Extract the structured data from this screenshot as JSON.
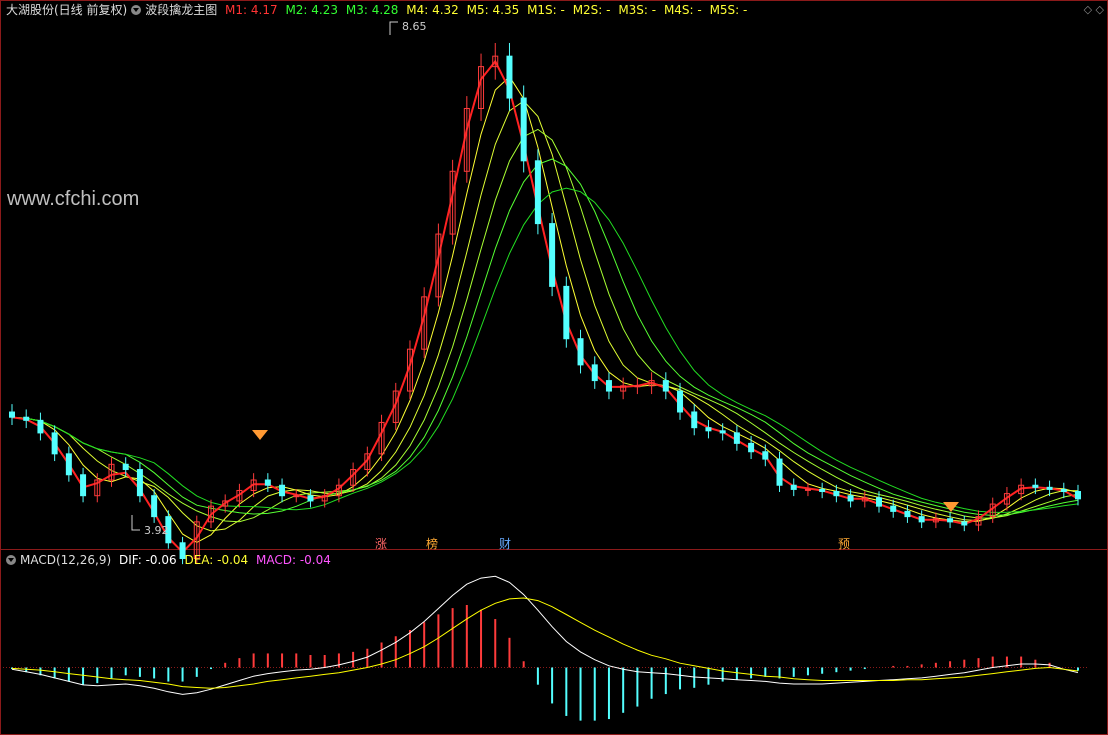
{
  "header": {
    "stock_name": "大湖股份(日线 前复权)",
    "indicator_name": "波段擒龙主图",
    "items": [
      {
        "label": "M1: 4.17",
        "color": "#ff3333"
      },
      {
        "label": "M2: 4.23",
        "color": "#33ff33"
      },
      {
        "label": "M3: 4.28",
        "color": "#33ff33"
      },
      {
        "label": "M4: 4.32",
        "color": "#ffff33"
      },
      {
        "label": "M5: 4.35",
        "color": "#ffff33"
      },
      {
        "label": "M1S: -",
        "color": "#ffff33"
      },
      {
        "label": "M2S: -",
        "color": "#ffff33"
      },
      {
        "label": "M3S: -",
        "color": "#ffff33"
      },
      {
        "label": "M4S: -",
        "color": "#ffff33"
      },
      {
        "label": "M5S: -",
        "color": "#ffff33"
      }
    ]
  },
  "watermark": "www.cfchi.com",
  "annotations": {
    "high": "8.65",
    "low": "3.92"
  },
  "event_tags": [
    {
      "text": "涨",
      "color": "#ff6666"
    },
    {
      "text": "榜",
      "color": "#ffaa33"
    },
    {
      "text": "财",
      "color": "#66aaff"
    },
    {
      "text": "预",
      "color": "#ffaa33"
    }
  ],
  "macd_header": {
    "name": "MACD(12,26,9)",
    "dif": "DIF: -0.06",
    "dea": "DEA: -0.04",
    "macd": "MACD: -0.04"
  },
  "colors": {
    "up": "#ff3b3b",
    "down": "#54ffff",
    "dif": "#ffffff",
    "dea": "#ffff00",
    "frame": "#8b1a1a"
  },
  "chart_data": [
    {
      "type": "candlestick",
      "title": "大湖股份(日线 前复权)",
      "ylim": [
        3.92,
        8.65
      ],
      "series": [
        {
          "name": "close",
          "values": [
            4.95,
            4.92,
            4.8,
            4.6,
            4.4,
            4.2,
            4.35,
            4.5,
            4.45,
            4.2,
            4.0,
            3.75,
            3.6,
            3.95,
            4.1,
            4.15,
            4.25,
            4.35,
            4.3,
            4.2,
            4.2,
            4.15,
            4.2,
            4.3,
            4.45,
            4.6,
            4.9,
            5.2,
            5.6,
            6.1,
            6.7,
            7.3,
            7.9,
            8.3,
            8.4,
            8.0,
            7.4,
            6.8,
            6.2,
            5.7,
            5.45,
            5.3,
            5.2,
            5.25,
            5.25,
            5.3,
            5.2,
            5.0,
            4.85,
            4.82,
            4.8,
            4.7,
            4.62,
            4.55,
            4.3,
            4.26,
            4.26,
            4.24,
            4.2,
            4.15,
            4.18,
            4.1,
            4.05,
            4.0,
            3.95,
            3.98,
            3.95,
            3.92,
            4.0,
            4.12,
            4.22,
            4.3,
            4.28,
            4.26,
            4.24,
            4.17
          ]
        },
        {
          "name": "M1",
          "values": [
            4.95,
            4.93,
            4.86,
            4.7,
            4.5,
            4.28,
            4.32,
            4.4,
            4.42,
            4.26,
            4.04,
            3.8,
            3.66,
            3.8,
            4.02,
            4.13,
            4.21,
            4.31,
            4.31,
            4.24,
            4.21,
            4.17,
            4.19,
            4.27,
            4.4,
            4.54,
            4.8,
            5.08,
            5.45,
            5.92,
            6.48,
            7.08,
            7.7,
            8.18,
            8.35,
            8.08,
            7.55,
            6.96,
            6.37,
            5.86,
            5.54,
            5.36,
            5.24,
            5.24,
            5.25,
            5.28,
            5.23,
            5.07,
            4.92,
            4.85,
            4.81,
            4.73,
            4.65,
            4.58,
            4.38,
            4.29,
            4.27,
            4.25,
            4.21,
            4.17,
            4.17,
            4.12,
            4.07,
            4.02,
            3.97,
            3.97,
            3.96,
            3.93,
            3.98,
            4.08,
            4.18,
            4.27,
            4.28,
            4.27,
            4.25,
            4.17
          ]
        }
      ]
    },
    {
      "type": "bar",
      "title": "MACD(12,26,9)",
      "series": [
        {
          "name": "DIF",
          "values": [
            -0.02,
            -0.05,
            -0.08,
            -0.12,
            -0.16,
            -0.2,
            -0.21,
            -0.2,
            -0.19,
            -0.21,
            -0.24,
            -0.28,
            -0.31,
            -0.29,
            -0.25,
            -0.2,
            -0.15,
            -0.1,
            -0.07,
            -0.05,
            -0.03,
            -0.02,
            0.0,
            0.03,
            0.07,
            0.12,
            0.2,
            0.29,
            0.4,
            0.53,
            0.68,
            0.83,
            0.96,
            1.03,
            1.05,
            0.98,
            0.84,
            0.66,
            0.47,
            0.3,
            0.18,
            0.09,
            0.02,
            -0.02,
            -0.05,
            -0.06,
            -0.07,
            -0.09,
            -0.11,
            -0.12,
            -0.13,
            -0.14,
            -0.15,
            -0.16,
            -0.18,
            -0.19,
            -0.19,
            -0.19,
            -0.18,
            -0.17,
            -0.16,
            -0.15,
            -0.14,
            -0.13,
            -0.12,
            -0.1,
            -0.08,
            -0.06,
            -0.03,
            0.0,
            0.02,
            0.04,
            0.04,
            0.03,
            -0.02,
            -0.06
          ]
        },
        {
          "name": "DEA",
          "values": [
            -0.01,
            -0.02,
            -0.03,
            -0.05,
            -0.07,
            -0.09,
            -0.11,
            -0.13,
            -0.14,
            -0.15,
            -0.17,
            -0.19,
            -0.22,
            -0.23,
            -0.24,
            -0.23,
            -0.21,
            -0.19,
            -0.16,
            -0.14,
            -0.12,
            -0.1,
            -0.08,
            -0.06,
            -0.03,
            0.0,
            0.04,
            0.09,
            0.16,
            0.24,
            0.34,
            0.45,
            0.56,
            0.66,
            0.74,
            0.79,
            0.8,
            0.77,
            0.7,
            0.61,
            0.52,
            0.43,
            0.35,
            0.27,
            0.2,
            0.14,
            0.1,
            0.05,
            0.02,
            -0.01,
            -0.04,
            -0.06,
            -0.08,
            -0.1,
            -0.11,
            -0.13,
            -0.14,
            -0.15,
            -0.15,
            -0.15,
            -0.15,
            -0.15,
            -0.15,
            -0.14,
            -0.14,
            -0.13,
            -0.12,
            -0.11,
            -0.09,
            -0.07,
            -0.05,
            -0.03,
            -0.01,
            0.0,
            -0.02,
            -0.04
          ]
        },
        {
          "name": "MACD",
          "values": [
            -0.02,
            -0.06,
            -0.1,
            -0.14,
            -0.18,
            -0.22,
            -0.2,
            -0.14,
            -0.1,
            -0.12,
            -0.14,
            -0.18,
            -0.18,
            -0.12,
            -0.02,
            0.06,
            0.12,
            0.18,
            0.18,
            0.18,
            0.18,
            0.16,
            0.16,
            0.18,
            0.2,
            0.24,
            0.32,
            0.4,
            0.48,
            0.58,
            0.68,
            0.76,
            0.8,
            0.74,
            0.62,
            0.38,
            0.08,
            -0.22,
            -0.46,
            -0.62,
            -0.68,
            -0.68,
            -0.66,
            -0.58,
            -0.5,
            -0.4,
            -0.34,
            -0.28,
            -0.26,
            -0.22,
            -0.18,
            -0.16,
            -0.14,
            -0.12,
            -0.14,
            -0.12,
            -0.1,
            -0.08,
            -0.06,
            -0.04,
            -0.02,
            0.0,
            0.02,
            0.02,
            0.04,
            0.06,
            0.08,
            0.1,
            0.12,
            0.14,
            0.14,
            0.14,
            0.1,
            0.06,
            0.0,
            -0.04
          ]
        }
      ]
    }
  ]
}
